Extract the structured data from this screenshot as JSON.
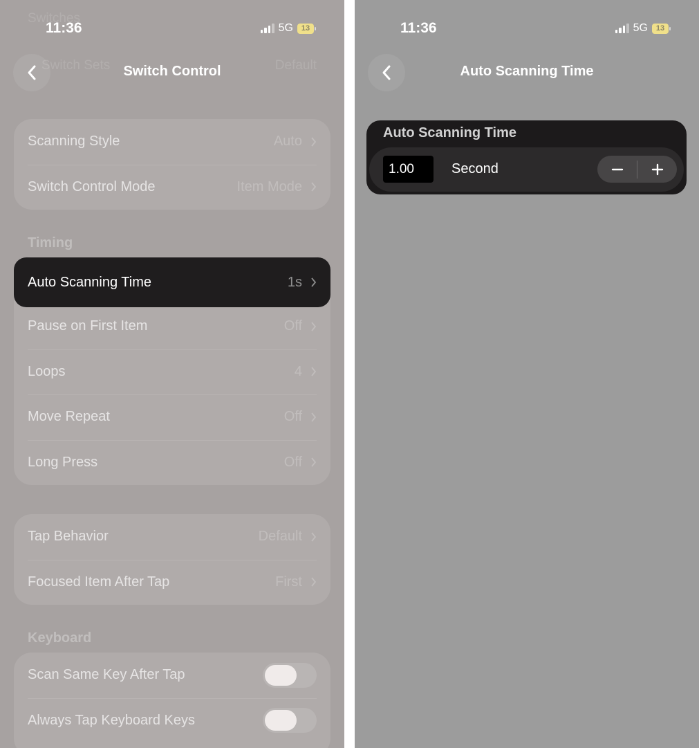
{
  "left": {
    "status": {
      "time": "11:36",
      "network": "5G",
      "battery": "13"
    },
    "background_ghost": {
      "row_label": "Switch Sets",
      "row_value": "Default",
      "header": "Switches"
    },
    "nav": {
      "title": "Switch Control",
      "back_icon": "chevron-left-icon"
    },
    "group1": [
      {
        "label": "Scanning Style",
        "value": "Auto"
      },
      {
        "label": "Switch Control Mode",
        "value": "Item Mode"
      }
    ],
    "timing_header": "Timing",
    "highlighted": {
      "label": "Auto Scanning Time",
      "value": "1s"
    },
    "timing_rows": [
      {
        "label": "Pause on First Item",
        "value": "Off"
      },
      {
        "label": "Loops",
        "value": "4"
      },
      {
        "label": "Move Repeat",
        "value": "Off"
      },
      {
        "label": "Long Press",
        "value": "Off"
      }
    ],
    "group3": [
      {
        "label": "Tap Behavior",
        "value": "Default"
      },
      {
        "label": "Focused Item After Tap",
        "value": "First"
      }
    ],
    "keyboard_header": "Keyboard",
    "keyboard_rows": [
      {
        "label": "Scan Same Key After Tap",
        "on": false
      },
      {
        "label": "Always Tap Keyboard Keys",
        "on": false
      }
    ]
  },
  "right": {
    "status": {
      "time": "11:36",
      "network": "5G",
      "battery": "13"
    },
    "nav": {
      "title": "Auto Scanning Time",
      "back_icon": "chevron-left-icon"
    },
    "section_header": "Auto Scanning Time",
    "value": "1.00",
    "unit": "Second",
    "decrement_icon": "minus-icon",
    "increment_icon": "plus-icon"
  },
  "colors": {
    "left_background": "#a7a2a1",
    "right_background": "#9c9c9c",
    "highlight": "#1f1d1e",
    "battery": "#f0e08a"
  }
}
